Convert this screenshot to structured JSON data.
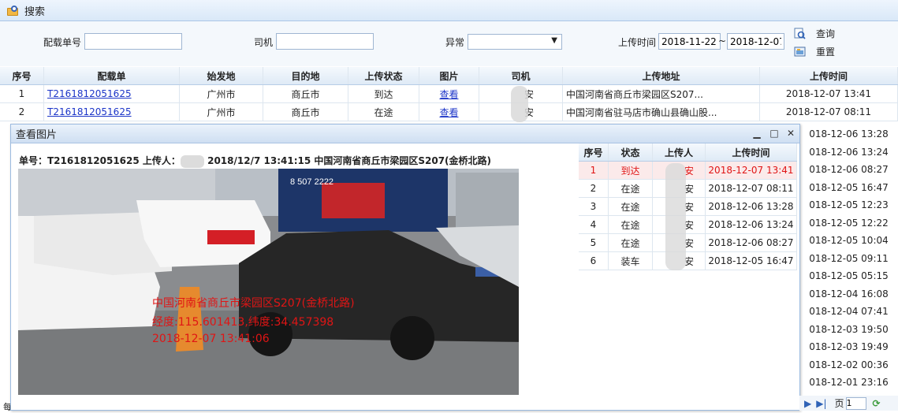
{
  "panel": {
    "title": "搜索"
  },
  "search": {
    "order_label": "配载单号",
    "order_value": "",
    "driver_label": "司机",
    "driver_value": "",
    "abnormal_label": "异常",
    "abnormal_value": "",
    "upload_time_label": "上传时间",
    "date_from": "2018-11-22",
    "date_sep": "~",
    "date_to": "2018-12-07",
    "query_label": "查询",
    "reset_label": "重置"
  },
  "table": {
    "headers": [
      "序号",
      "配载单",
      "始发地",
      "目的地",
      "上传状态",
      "图片",
      "司机",
      "上传地址",
      "上传时间"
    ],
    "rows": [
      {
        "no": "1",
        "order": "T2161812051625",
        "from": "广州市",
        "to": "商丘市",
        "status": "到达",
        "pic": "查看",
        "driver": "安",
        "addr": "中国河南省商丘市梁园区S207...",
        "time": "2018-12-07 13:41"
      },
      {
        "no": "2",
        "order": "T2161812051625",
        "from": "广州市",
        "to": "商丘市",
        "status": "在途",
        "pic": "查看",
        "driver": "安",
        "addr": "中国河南省驻马店市确山县确山股...",
        "time": "2018-12-07 08:11"
      }
    ],
    "hidden_times": [
      "018-12-06 13:28",
      "018-12-06 13:24",
      "018-12-06 08:27",
      "018-12-05 16:47",
      "018-12-05 12:23",
      "018-12-05 12:22",
      "018-12-05 10:04",
      "018-12-05 09:11",
      "018-12-05 05:15",
      "018-12-04 16:08",
      "018-12-04 07:41",
      "018-12-03 19:50",
      "018-12-03 19:49",
      "018-12-02 00:36",
      "018-12-01 23:16"
    ],
    "left_stub": "每"
  },
  "dialog": {
    "title": "查看图片",
    "info_prefix": "单号：T2161812051625 上传人：",
    "info_suffix": " 2018/12/7 13:41:15 中国河南省商丘市梁园区S207(金桥北路)",
    "photo_caption": {
      "line1": "中国河南省商丘市梁园区S207(金桥北路)",
      "line2": "经度:115.601413,纬度:34.457398",
      "line3": "2018-12-07 13:41:06"
    },
    "billboard_text": "8 507 2222",
    "mini_headers": [
      "序号",
      "状态",
      "上传人",
      "上传时间"
    ],
    "mini_rows": [
      {
        "no": "1",
        "status": "到达",
        "who": "安",
        "time": "2018-12-07 13:41",
        "selected": true
      },
      {
        "no": "2",
        "status": "在途",
        "who": "安",
        "time": "2018-12-07 08:11",
        "selected": false
      },
      {
        "no": "3",
        "status": "在途",
        "who": "安",
        "time": "2018-12-06 13:28",
        "selected": false
      },
      {
        "no": "4",
        "status": "在途",
        "who": "安",
        "time": "2018-12-06 13:24",
        "selected": false
      },
      {
        "no": "5",
        "status": "在途",
        "who": "安",
        "time": "2018-12-06 08:27",
        "selected": false
      },
      {
        "no": "6",
        "status": "装车",
        "who": "安",
        "time": "2018-12-05 16:47",
        "selected": false
      }
    ]
  },
  "pager": {
    "page_label": "页",
    "page_value": "1"
  },
  "colors": {
    "accent": "#1c35c8",
    "alert": "#e01515",
    "header_bg": "#dfeaf6"
  }
}
